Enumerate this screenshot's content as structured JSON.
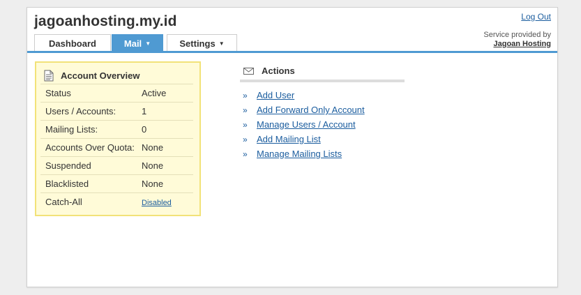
{
  "header": {
    "site_title": "jagoanhosting.my.id",
    "logout_label": "Log Out",
    "provided_by_label": "Service provided by",
    "provider_name": "Jagoan Hosting"
  },
  "tabs": [
    {
      "label": "Dashboard",
      "active": false,
      "has_menu": false
    },
    {
      "label": "Mail",
      "active": true,
      "has_menu": true
    },
    {
      "label": "Settings",
      "active": false,
      "has_menu": true
    }
  ],
  "overview": {
    "title": "Account Overview",
    "icon": "document-icon",
    "rows": [
      {
        "label": "Status",
        "value": "Active"
      },
      {
        "label": "Users / Accounts:",
        "value": "1"
      },
      {
        "label": "Mailing Lists:",
        "value": "0"
      },
      {
        "label": "Accounts Over Quota:",
        "value": "None"
      },
      {
        "label": "Suspended",
        "value": "None"
      },
      {
        "label": "Blacklisted",
        "value": "None"
      },
      {
        "label": "Catch-All",
        "value": "Disabled",
        "is_link": true
      }
    ]
  },
  "actions": {
    "title": "Actions",
    "icon": "envelope-icon",
    "bullet": "»",
    "items": [
      {
        "label": "Add User"
      },
      {
        "label": "Add Forward Only Account"
      },
      {
        "label": "Manage Users / Account"
      },
      {
        "label": "Add Mailing List"
      },
      {
        "label": "Manage Mailing Lists"
      }
    ]
  },
  "colors": {
    "accent": "#4f9ad2",
    "link": "#1a5c9e",
    "overview_bg": "#fffbd8",
    "overview_border": "#f2e278"
  }
}
